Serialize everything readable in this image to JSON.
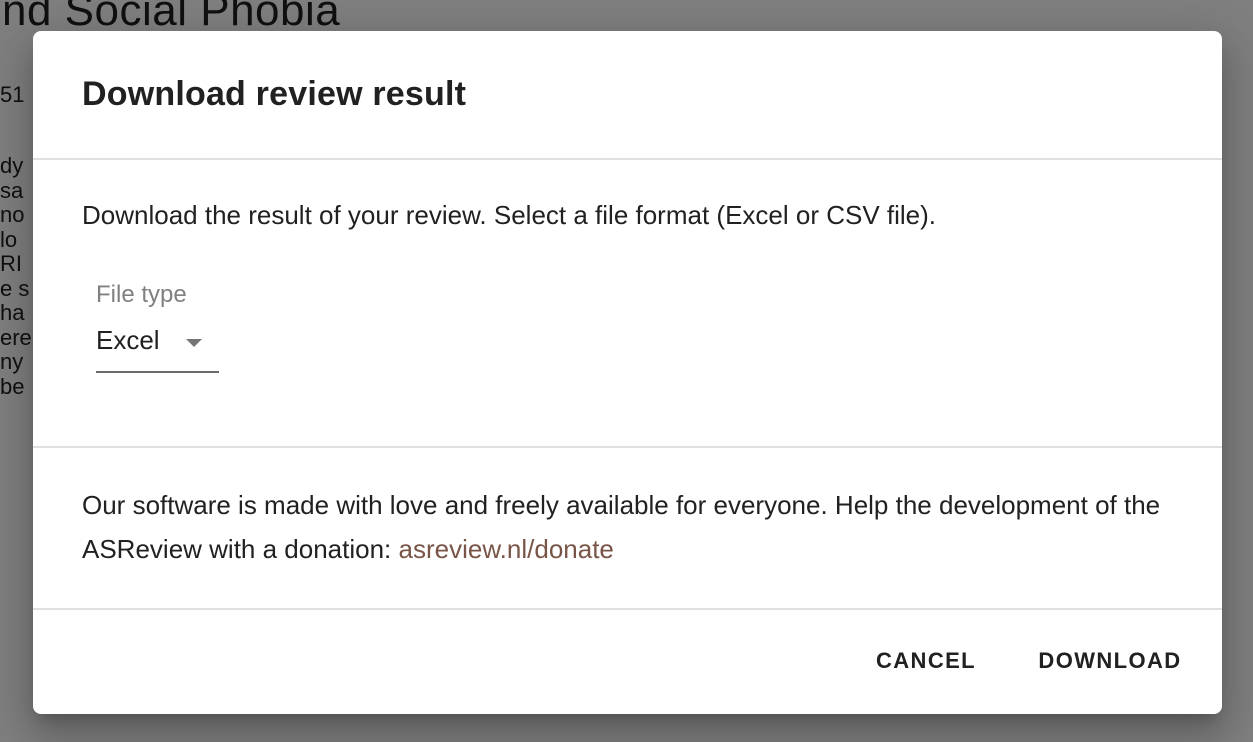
{
  "background": {
    "title": "nd Social Phobia",
    "code": "51",
    "lines": [
      "dy",
      "sa",
      "no",
      "lo",
      "RI",
      "e s",
      "ha",
      "ere",
      "ny",
      "be"
    ]
  },
  "dialog": {
    "title": "Download review result",
    "description": "Download the result of your review. Select a file format (Excel or CSV file).",
    "file_type": {
      "label": "File type",
      "value": "Excel"
    },
    "donate": {
      "text": "Our software is made with love and freely available for everyone. Help the development of the ASReview with a donation: ",
      "link": "asreview.nl/donate"
    },
    "actions": {
      "cancel": "CANCEL",
      "download": "DOWNLOAD"
    }
  },
  "colors": {
    "link": "#795548",
    "overlay": "rgba(0,0,0,0.5)"
  },
  "icons": {
    "dropdown": "arrow-drop-down-icon"
  }
}
